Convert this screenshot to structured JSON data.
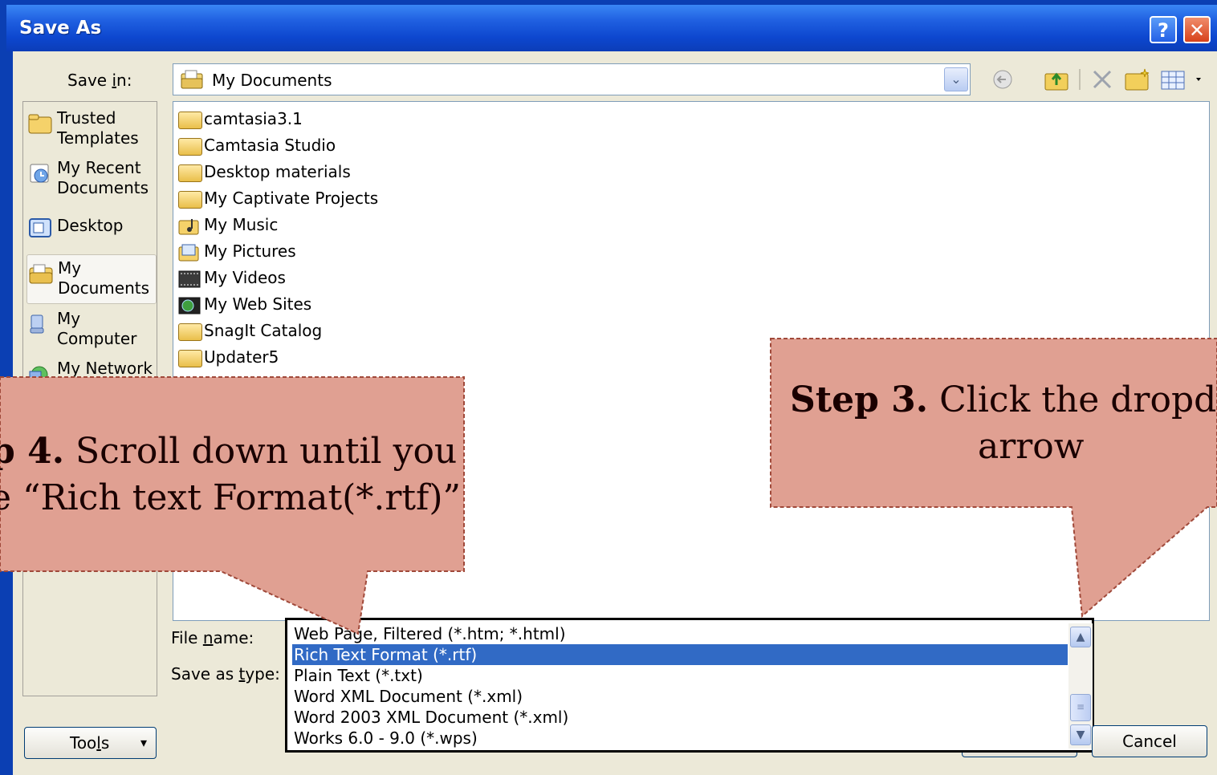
{
  "dialog": {
    "title": "Save As",
    "help_glyph": "?",
    "close_glyph": "✕"
  },
  "toolbar": {
    "save_in_label_pre": "Save ",
    "save_in_label_accel": "i",
    "save_in_label_post": "n:",
    "save_in_value": "My Documents",
    "arrow_glyph": "⌄",
    "icons": [
      "back-icon",
      "up-folder-icon",
      "delete-icon",
      "new-folder-icon",
      "views-icon"
    ]
  },
  "places": [
    {
      "label_1": "Trusted",
      "label_2": "Templates"
    },
    {
      "label_1": "My Recent",
      "label_2": "Documents"
    },
    {
      "label_1": "Desktop",
      "label_2": ""
    },
    {
      "label_1": "My",
      "label_2": "Documents"
    },
    {
      "label_1": "My",
      "label_2": "Computer"
    },
    {
      "label_1": "My Network",
      "label_2": ""
    }
  ],
  "files": [
    "camtasia3.1",
    "Camtasia Studio",
    "Desktop materials",
    "My Captivate Projects",
    "My Music",
    "My Pictures",
    "My Videos",
    "My Web Sites",
    "SnagIt Catalog",
    "Updater5"
  ],
  "form": {
    "file_name_pre": "File ",
    "file_name_accel": "n",
    "file_name_post": "ame:",
    "save_type_pre": "Save as ",
    "save_type_accel": "t",
    "save_type_post": "ype:"
  },
  "type_options": [
    "Web Page, Filtered (*.htm; *.html)",
    "Rich Text Format (*.rtf)",
    "Plain Text (*.txt)",
    "Word XML Document (*.xml)",
    "Word 2003 XML Document (*.xml)",
    "Works 6.0 - 9.0 (*.wps)"
  ],
  "selected_option_index": 1,
  "buttons": {
    "tools_pre": "Too",
    "tools_accel": "l",
    "tools_post": "s",
    "tools_arrow": "▾",
    "cancel": "Cancel"
  },
  "callouts": {
    "step4_bold": "p 4.",
    "step4_line1": " Scroll down until you",
    "step4_line2": "e “Rich text Format(*.rtf)”",
    "step3_bold": "Step 3.",
    "step3_line1": " Click the dropdo",
    "step3_line2": "arrow"
  },
  "colors": {
    "callout_fill": "#e0a092",
    "callout_border": "#a0493a",
    "selection": "#316ac5",
    "title_bar": "#0d47cf"
  }
}
